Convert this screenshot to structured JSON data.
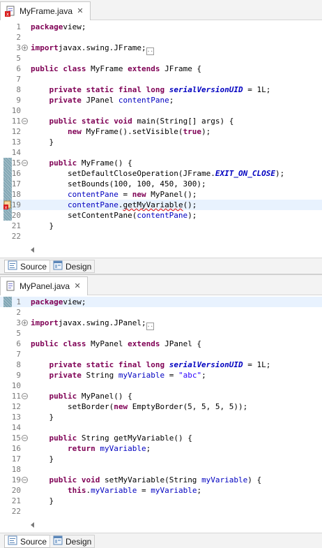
{
  "editors": [
    {
      "tab_label": "MyFrame.java",
      "tab_has_error": true,
      "occurrence_markers": [
        15,
        16,
        17,
        18,
        19,
        20
      ],
      "error_line": 19,
      "highlight_line": 19,
      "lines": [
        {
          "n": "1",
          "t": [
            [
              "kw",
              "package"
            ],
            [
              "",
              "view;"
            ]
          ]
        },
        {
          "n": "2",
          "t": []
        },
        {
          "n": "3",
          "fold": "plus",
          "t": [
            [
              "kw",
              "import"
            ],
            [
              "",
              "javax.swing.JFrame;"
            ],
            [
              "dots",
              ""
            ]
          ]
        },
        {
          "n": "5",
          "t": []
        },
        {
          "n": "6",
          "t": [
            [
              "kw",
              "public class"
            ],
            [
              "",
              " MyFrame "
            ],
            [
              "kw",
              "extends"
            ],
            [
              "",
              " JFrame {"
            ]
          ]
        },
        {
          "n": "7",
          "t": []
        },
        {
          "n": "8",
          "t": [
            [
              "",
              "    "
            ],
            [
              "kw",
              "private static final long"
            ],
            [
              "",
              " "
            ],
            [
              "sfi",
              "serialVersionUID"
            ],
            [
              "",
              " = 1L;"
            ]
          ]
        },
        {
          "n": "9",
          "t": [
            [
              "",
              "    "
            ],
            [
              "kw",
              "private"
            ],
            [
              "",
              " JPanel "
            ],
            [
              "fld",
              "contentPane"
            ],
            [
              "",
              ";"
            ]
          ]
        },
        {
          "n": "10",
          "t": []
        },
        {
          "n": "11",
          "fold": "minus",
          "t": [
            [
              "",
              "    "
            ],
            [
              "kw",
              "public static void"
            ],
            [
              "",
              " main(String[] args) {"
            ]
          ]
        },
        {
          "n": "12",
          "t": [
            [
              "",
              "        "
            ],
            [
              "kw",
              "new"
            ],
            [
              "",
              " MyFrame().setVisible("
            ],
            [
              "kw",
              "true"
            ],
            [
              "",
              ");"
            ]
          ]
        },
        {
          "n": "13",
          "t": [
            [
              "",
              "    }"
            ]
          ]
        },
        {
          "n": "14",
          "t": []
        },
        {
          "n": "15",
          "fold": "minus",
          "t": [
            [
              "",
              "    "
            ],
            [
              "kw",
              "public"
            ],
            [
              "",
              " MyFrame() {"
            ]
          ]
        },
        {
          "n": "16",
          "t": [
            [
              "",
              "        setDefaultCloseOperation(JFrame."
            ],
            [
              "sfi",
              "EXIT_ON_CLOSE"
            ],
            [
              "",
              ");"
            ]
          ]
        },
        {
          "n": "17",
          "t": [
            [
              "",
              "        setBounds(100, 100, 450, 300);"
            ]
          ]
        },
        {
          "n": "18",
          "t": [
            [
              "",
              "        "
            ],
            [
              "fld",
              "contentPane"
            ],
            [
              "",
              " = "
            ],
            [
              "kw",
              "new"
            ],
            [
              "",
              " MyPanel();"
            ]
          ]
        },
        {
          "n": "19",
          "t": [
            [
              "",
              "        "
            ],
            [
              "fld",
              "contentPane"
            ],
            [
              "",
              "."
            ],
            [
              "squig",
              "getMyVariable"
            ],
            [
              "",
              "();"
            ]
          ]
        },
        {
          "n": "20",
          "t": [
            [
              "",
              "        setContentPane("
            ],
            [
              "fld",
              "contentPane"
            ],
            [
              "",
              ");"
            ]
          ]
        },
        {
          "n": "21",
          "t": [
            [
              "",
              "    }"
            ]
          ]
        },
        {
          "n": "22",
          "t": []
        }
      ]
    },
    {
      "tab_label": "MyPanel.java",
      "tab_has_error": false,
      "occurrence_markers": [
        1
      ],
      "error_line": null,
      "highlight_line": 1,
      "lines": [
        {
          "n": "1",
          "t": [
            [
              "kw",
              "package"
            ],
            [
              "",
              "view;"
            ]
          ]
        },
        {
          "n": "2",
          "t": []
        },
        {
          "n": "3",
          "fold": "plus",
          "t": [
            [
              "kw",
              "import"
            ],
            [
              "",
              "javax.swing.JPanel;"
            ],
            [
              "dots",
              ""
            ]
          ]
        },
        {
          "n": "5",
          "t": []
        },
        {
          "n": "6",
          "t": [
            [
              "kw",
              "public class"
            ],
            [
              "",
              " MyPanel "
            ],
            [
              "kw",
              "extends"
            ],
            [
              "",
              " JPanel {"
            ]
          ]
        },
        {
          "n": "7",
          "t": []
        },
        {
          "n": "8",
          "t": [
            [
              "",
              "    "
            ],
            [
              "kw",
              "private static final long"
            ],
            [
              "",
              " "
            ],
            [
              "sfi",
              "serialVersionUID"
            ],
            [
              "",
              " = 1L;"
            ]
          ]
        },
        {
          "n": "9",
          "t": [
            [
              "",
              "    "
            ],
            [
              "kw",
              "private"
            ],
            [
              "",
              " String "
            ],
            [
              "fld",
              "myVariable"
            ],
            [
              "",
              " = "
            ],
            [
              "str",
              "\"abc\""
            ],
            [
              "",
              ";"
            ]
          ]
        },
        {
          "n": "10",
          "t": []
        },
        {
          "n": "11",
          "fold": "minus",
          "t": [
            [
              "",
              "    "
            ],
            [
              "kw",
              "public"
            ],
            [
              "",
              " MyPanel() {"
            ]
          ]
        },
        {
          "n": "12",
          "t": [
            [
              "",
              "        setBorder("
            ],
            [
              "kw",
              "new"
            ],
            [
              "",
              " EmptyBorder(5, 5, 5, 5));"
            ]
          ]
        },
        {
          "n": "13",
          "t": [
            [
              "",
              "    }"
            ]
          ]
        },
        {
          "n": "14",
          "t": []
        },
        {
          "n": "15",
          "fold": "minus",
          "t": [
            [
              "",
              "    "
            ],
            [
              "kw",
              "public"
            ],
            [
              "",
              " String getMyVariable() {"
            ]
          ]
        },
        {
          "n": "16",
          "t": [
            [
              "",
              "        "
            ],
            [
              "kw",
              "return"
            ],
            [
              "",
              " "
            ],
            [
              "fld",
              "myVariable"
            ],
            [
              "",
              ";"
            ]
          ]
        },
        {
          "n": "17",
          "t": [
            [
              "",
              "    }"
            ]
          ]
        },
        {
          "n": "18",
          "t": []
        },
        {
          "n": "19",
          "fold": "minus",
          "t": [
            [
              "",
              "    "
            ],
            [
              "kw",
              "public void"
            ],
            [
              "",
              " setMyVariable(String "
            ],
            [
              "fld",
              "myVariable"
            ],
            [
              "",
              ") {"
            ]
          ]
        },
        {
          "n": "20",
          "t": [
            [
              "",
              "        "
            ],
            [
              "kw",
              "this"
            ],
            [
              "",
              "."
            ],
            [
              "fld",
              "myVariable"
            ],
            [
              "",
              " = "
            ],
            [
              "fld",
              "myVariable"
            ],
            [
              "",
              ";"
            ]
          ]
        },
        {
          "n": "21",
          "t": [
            [
              "",
              "    }"
            ]
          ]
        },
        {
          "n": "22",
          "t": []
        }
      ]
    }
  ],
  "bottom_tabs": {
    "source": "Source",
    "design": "Design"
  },
  "colors": {
    "keyword": "#7f0055",
    "field": "#0000c0",
    "string": "#2a00ff",
    "line_highlight": "#e8f2fe",
    "error": "#e02020",
    "occurrence_marker": "#6f99a9"
  },
  "icons": [
    "java-file-icon",
    "java-error-file-icon",
    "close-icon",
    "fold-plus-icon",
    "fold-minus-icon",
    "error-marker-icon",
    "source-icon",
    "design-icon"
  ]
}
